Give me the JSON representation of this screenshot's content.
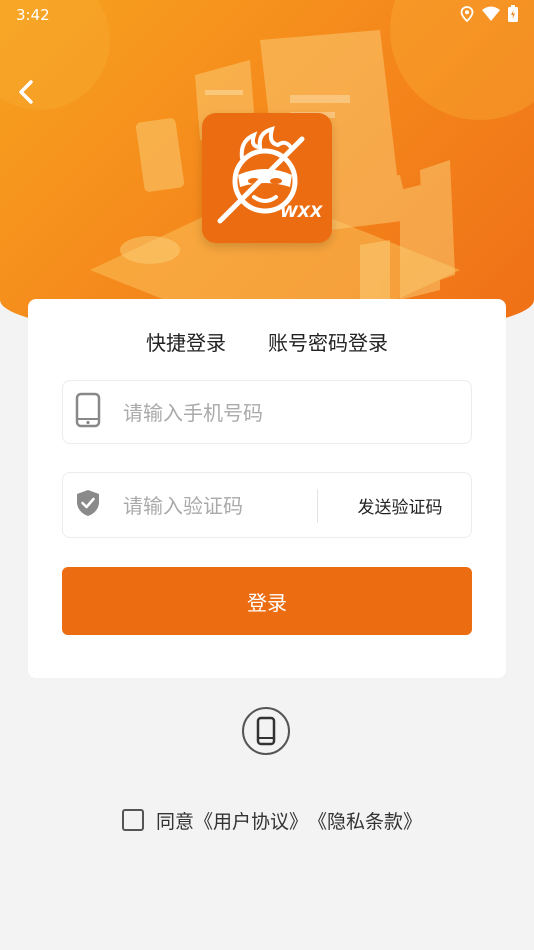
{
  "status_bar": {
    "time": "3:42",
    "icons": [
      "location-icon",
      "wifi-icon",
      "battery-icon"
    ]
  },
  "header": {
    "back_icon": "chevron-left-icon",
    "logo": {
      "text": "WXX",
      "icon": "monkey-mascot-logo"
    }
  },
  "login_card": {
    "tabs": [
      {
        "label": "快捷登录",
        "active": true
      },
      {
        "label": "账号密码登录",
        "active": false
      }
    ],
    "phone_field": {
      "icon": "mobile-phone-icon",
      "value": "",
      "placeholder": "请输入手机号码"
    },
    "code_field": {
      "icon": "shield-check-icon",
      "value": "",
      "placeholder": "请输入验证码"
    },
    "send_code_label": "发送验证码",
    "login_button_label": "登录"
  },
  "alt_login": {
    "icon": "mobile-phone-circle-icon"
  },
  "agreement": {
    "checked": false,
    "prefix": "同意",
    "user_agreement": "《用户协议》",
    "privacy_policy": "《隐私条款》"
  },
  "colors": {
    "accent": "#EC6C11",
    "hero_gradient_start": "#F7A21E",
    "hero_gradient_end": "#EF6F16",
    "background": "#F3F3F3"
  }
}
